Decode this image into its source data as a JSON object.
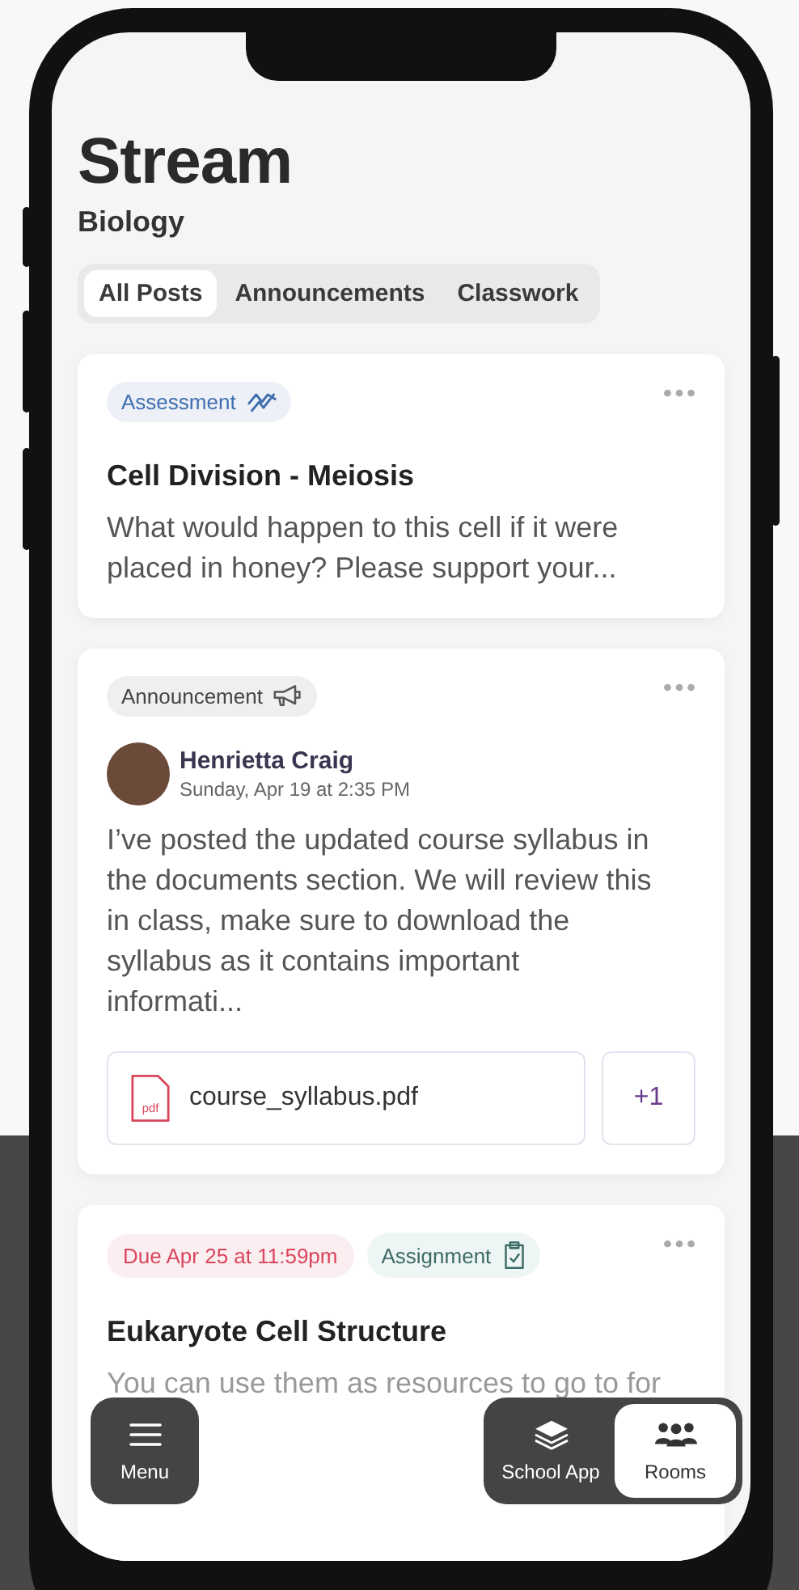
{
  "header": {
    "title": "Stream",
    "subtitle": "Biology"
  },
  "tabs": [
    {
      "label": "All Posts",
      "selected": true
    },
    {
      "label": "Announcements",
      "selected": false
    },
    {
      "label": "Classwork",
      "selected": false
    }
  ],
  "posts": [
    {
      "tags": [
        {
          "kind": "assessment",
          "label": "Assessment"
        }
      ],
      "title": "Cell Division - Meiosis",
      "body": "What would happen to this cell if it were placed in honey? Please support your..."
    },
    {
      "tags": [
        {
          "kind": "announcement",
          "label": "Announcement"
        }
      ],
      "author": {
        "name": "Henrietta Craig",
        "time": "Sunday, Apr 19 at 2:35 PM"
      },
      "body": "I’ve posted the updated course syllabus in the documents section. We will review this in class, make sure to download the syllabus as it contains important informati...",
      "attachment": {
        "icon_label": "pdf",
        "file": "course_syllabus.pdf",
        "more": "+1"
      }
    },
    {
      "tags": [
        {
          "kind": "due",
          "label": "Due Apr 25 at 11:59pm"
        },
        {
          "kind": "assignment",
          "label": "Assignment"
        }
      ],
      "title": "Eukaryote Cell Structure",
      "body": "You can use them as resources to go to for",
      "faded": true
    }
  ],
  "nav": [
    {
      "kind": "menu",
      "label": "Menu",
      "selected": false
    },
    {
      "kind": "layers",
      "label": "School App",
      "selected": false
    },
    {
      "kind": "rooms",
      "label": "Rooms",
      "selected": true
    }
  ]
}
